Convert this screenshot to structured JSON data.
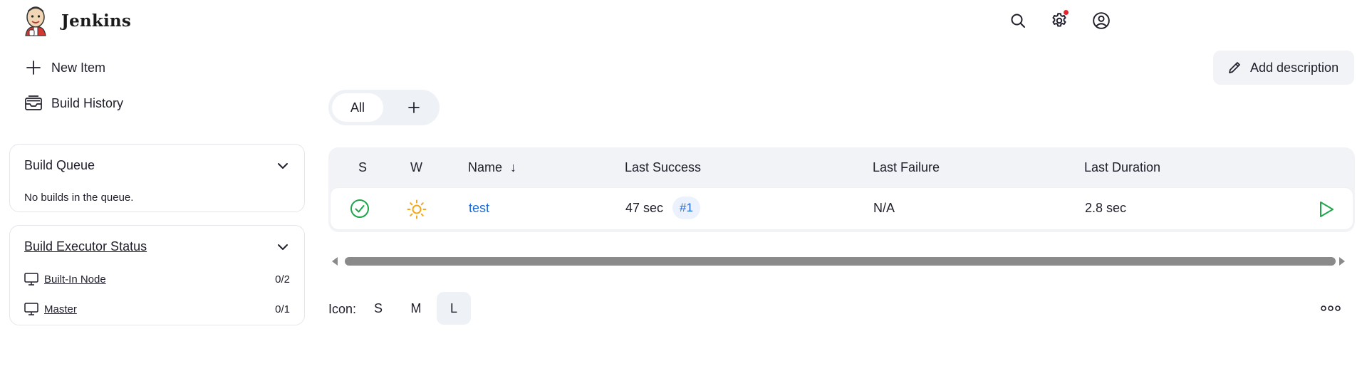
{
  "header": {
    "brand": "Jenkins",
    "icons": {
      "search": "search-icon",
      "settings": "gear-icon",
      "user": "user-icon"
    },
    "notification_color": "#e5242f"
  },
  "tasks": [
    {
      "label": "New Item",
      "icon": "plus-icon"
    },
    {
      "label": "Build History",
      "icon": "inbox-icon"
    }
  ],
  "build_queue": {
    "title": "Build Queue",
    "empty_text": "No builds in the queue."
  },
  "executor_status": {
    "title": "Build Executor Status",
    "nodes": [
      {
        "name": "Built-In Node",
        "count": "0/2"
      },
      {
        "name": "Master",
        "count": "0/1"
      }
    ]
  },
  "actions": {
    "add_description": "Add description"
  },
  "tabs": {
    "all": "All"
  },
  "table": {
    "columns": {
      "s": "S",
      "w": "W",
      "name": "Name",
      "sort_arrow": "↓",
      "last_success": "Last Success",
      "last_failure": "Last Failure",
      "last_duration": "Last Duration"
    },
    "rows": [
      {
        "status": "success",
        "weather": "sunny",
        "name": "test",
        "last_success": "47 sec",
        "build": "#1",
        "last_failure": "N/A",
        "last_duration": "2.8 sec"
      }
    ]
  },
  "icon_size": {
    "label": "Icon:",
    "options": [
      "S",
      "M",
      "L"
    ],
    "selected": "L"
  },
  "colors": {
    "success": "#1ea64b",
    "sun": "#f3a81b",
    "link": "#1f6bd1",
    "accent_bg": "#f1f3f7"
  }
}
